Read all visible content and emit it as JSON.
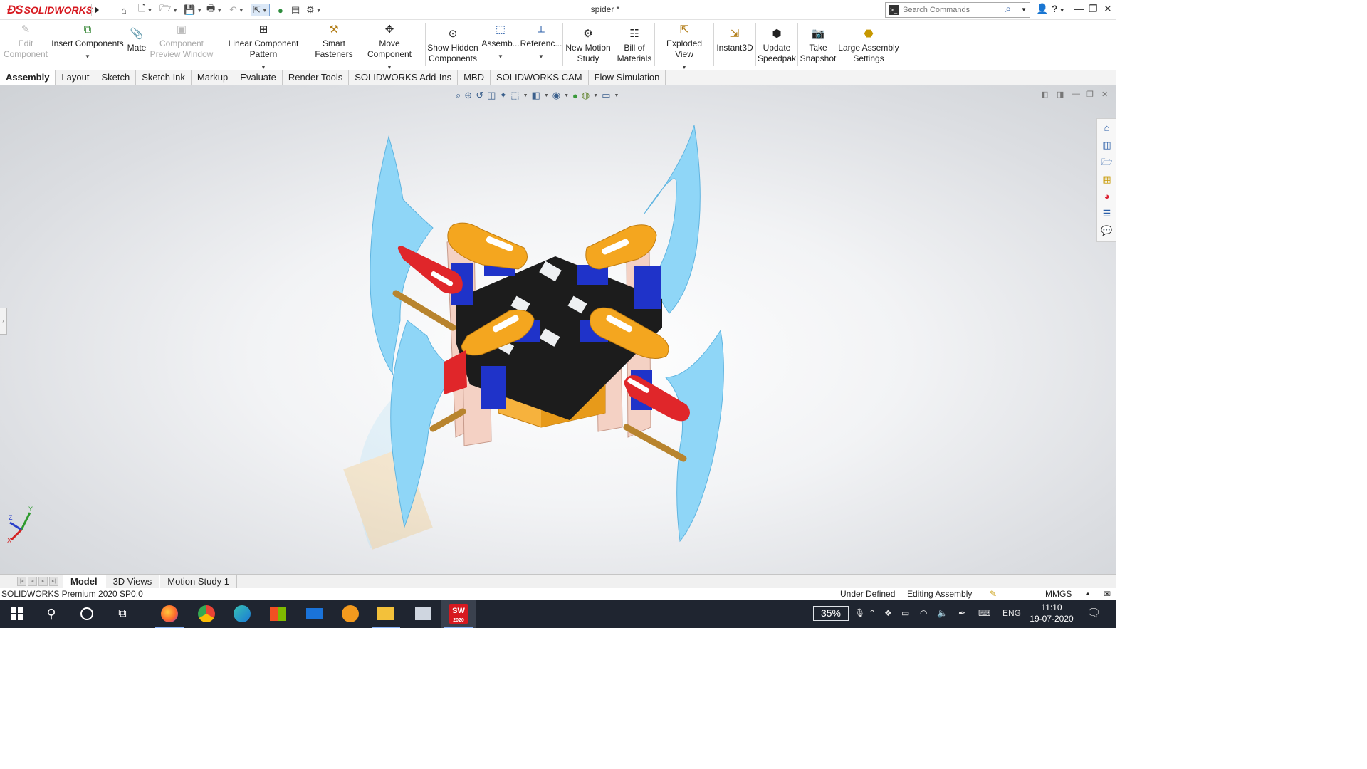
{
  "app": {
    "brand": "SOLIDWORKS",
    "document_title": "spider *",
    "search_placeholder": "Search Commands",
    "help_label": "?"
  },
  "ribbon": [
    {
      "id": "edit-component",
      "label_1": "Edit",
      "label_2": "Component",
      "icon": "edit-component-icon",
      "disabled": true
    },
    {
      "id": "insert-components",
      "label_1": "Insert Components",
      "label_2": "",
      "icon": "insert-components-icon",
      "dropdown": true
    },
    {
      "id": "mate",
      "label_1": "Mate",
      "label_2": "",
      "icon": "paperclip-icon"
    },
    {
      "id": "component-preview-window",
      "label_1": "Component",
      "label_2": "Preview Window",
      "icon": "preview-window-icon",
      "disabled": true
    },
    {
      "id": "linear-component-pattern",
      "label_1": "Linear Component Pattern",
      "label_2": "",
      "icon": "pattern-grid-icon",
      "dropdown": true
    },
    {
      "id": "smart-fasteners",
      "label_1": "Smart",
      "label_2": "Fasteners",
      "icon": "fastener-icon"
    },
    {
      "id": "move-component",
      "label_1": "Move Component",
      "label_2": "",
      "icon": "move-icon",
      "dropdown": true
    },
    {
      "id": "show-hidden-components",
      "label_1": "Show Hidden",
      "label_2": "Components",
      "icon": "glasses-icon"
    },
    {
      "id": "assembly-features",
      "label_1": "Assemb...",
      "label_2": "",
      "icon": "assembly-feature-icon",
      "dropdown": true
    },
    {
      "id": "reference-geometry",
      "label_1": "Referenc...",
      "label_2": "",
      "icon": "reference-geometry-icon",
      "dropdown": true
    },
    {
      "id": "new-motion-study",
      "label_1": "New Motion",
      "label_2": "Study",
      "icon": "motion-study-icon"
    },
    {
      "id": "bill-of-materials",
      "label_1": "Bill of",
      "label_2": "Materials",
      "icon": "bom-icon"
    },
    {
      "id": "exploded-view",
      "label_1": "Exploded View",
      "label_2": "",
      "icon": "exploded-view-icon",
      "dropdown": true
    },
    {
      "id": "instant3d",
      "label_1": "Instant3D",
      "label_2": "",
      "icon": "instant3d-icon"
    },
    {
      "id": "update-speedpak",
      "label_1": "Update",
      "label_2": "Speedpak",
      "icon": "speedpak-icon"
    },
    {
      "id": "take-snapshot",
      "label_1": "Take",
      "label_2": "Snapshot",
      "icon": "camera-icon"
    },
    {
      "id": "large-assembly-settings",
      "label_1": "Large Assembly",
      "label_2": "Settings",
      "icon": "large-assembly-icon"
    }
  ],
  "tabs": [
    "Assembly",
    "Layout",
    "Sketch",
    "Sketch Ink",
    "Markup",
    "Evaluate",
    "Render Tools",
    "SOLIDWORKS Add-Ins",
    "MBD",
    "SOLIDWORKS CAM",
    "Flow Simulation"
  ],
  "active_tab": "Assembly",
  "triad": {
    "x": "X",
    "y": "Y",
    "z": "Z"
  },
  "model_tabs": [
    "Model",
    "3D Views",
    "Motion Study 1"
  ],
  "active_model_tab": "Model",
  "status": {
    "version": "SOLIDWORKS Premium 2020 SP0.0",
    "definition": "Under Defined",
    "mode": "Editing Assembly",
    "units": "MMGS",
    "units_arrow": "▲"
  },
  "taskbar": {
    "apps": [
      "start",
      "search",
      "cortana",
      "task-view",
      "firefox",
      "chrome",
      "edge",
      "store",
      "mail",
      "brave",
      "file-explorer",
      "photos",
      "solidworks"
    ],
    "solidworks_label": "SW",
    "solidworks_year": "2020",
    "battery_percent": "35%",
    "language": "ENG",
    "time": "11:10",
    "date": "19-07-2020"
  },
  "colors": {
    "brand_red": "#d71920",
    "leg_blue": "#8fd6f7",
    "bracket_orange": "#f4a61f",
    "servo_blue": "#1f33c9",
    "horn_red": "#e0262a",
    "frame_black": "#1c1c1c",
    "pink_plate": "#f4d1c4",
    "taskbar_bg": "#1f2530"
  }
}
